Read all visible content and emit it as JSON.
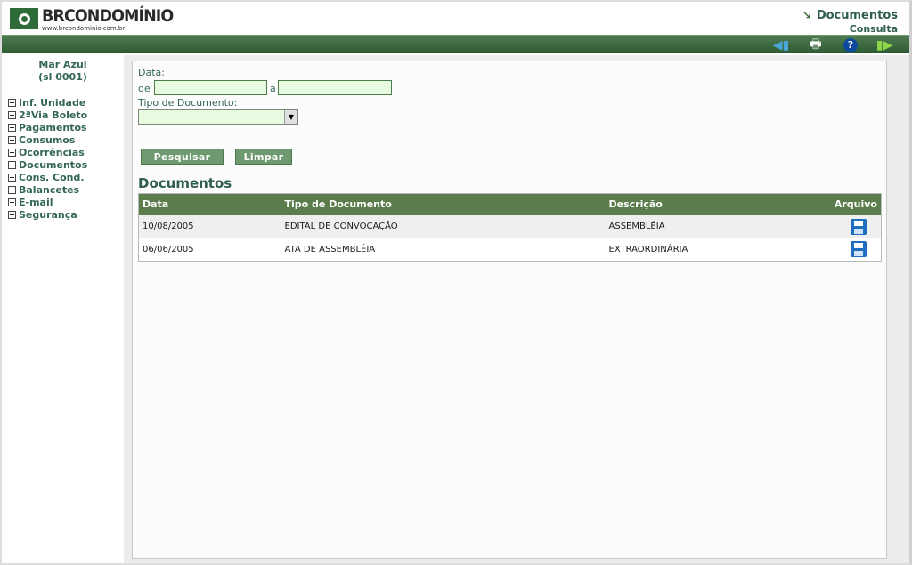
{
  "header": {
    "brand": "BRCONDOMÍNIO",
    "url": "www.brcondominio.com.br",
    "title": "Documentos",
    "subtitle": "Consulta"
  },
  "toolbar": {
    "icons": [
      "back-arrow-icon",
      "printer-icon",
      "help-icon",
      "exit-arrow-icon"
    ]
  },
  "sidebar": {
    "unit_name": "Mar Azul",
    "unit_code": "(sl 0001)",
    "items": [
      {
        "label": "Inf. Unidade"
      },
      {
        "label": "2ªVia Boleto"
      },
      {
        "label": "Pagamentos"
      },
      {
        "label": "Consumos"
      },
      {
        "label": "Ocorrências"
      },
      {
        "label": "Documentos"
      },
      {
        "label": "Cons. Cond."
      },
      {
        "label": "Balancetes"
      },
      {
        "label": "E-mail"
      },
      {
        "label": "Segurança"
      }
    ]
  },
  "form": {
    "date_label": "Data:",
    "from_label": "de",
    "to_label": "a",
    "from_value": "",
    "to_value": "",
    "type_label": "Tipo de Documento:",
    "type_value": "",
    "search_button": "Pesquisar",
    "clear_button": "Limpar"
  },
  "results": {
    "title": "Documentos",
    "columns": [
      "Data",
      "Tipo de Documento",
      "Descrição",
      "Arquivo"
    ],
    "rows": [
      {
        "data": "10/08/2005",
        "tipo": "EDITAL DE CONVOCAÇÃO",
        "descricao": "ASSEMBLÉIA"
      },
      {
        "data": "06/06/2005",
        "tipo": "ATA DE ASSEMBLÉIA",
        "descricao": "EXTRAORDINÁRIA"
      }
    ]
  },
  "colors": {
    "accent_green": "#336655",
    "bar_green": "#3d6b3f",
    "table_header": "#5b7d4c",
    "input_bg": "#e8fbe0",
    "file_icon": "#1f6ec0"
  }
}
